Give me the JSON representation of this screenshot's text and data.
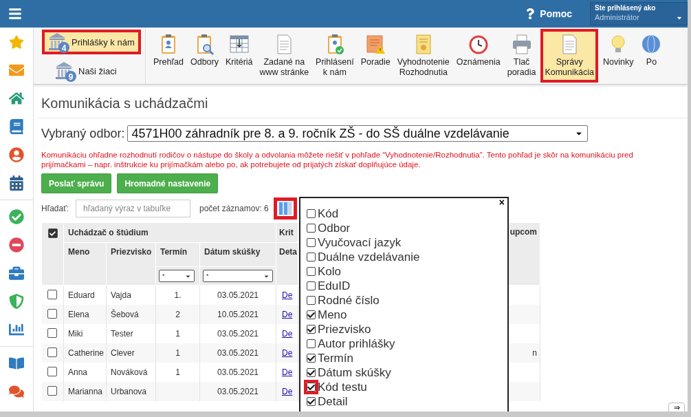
{
  "header": {
    "help": "Pomoc",
    "user_label": "Ste prihlásený ako",
    "user": "Administrátor"
  },
  "toolbar": {
    "left": [
      {
        "label": "Prihlášky k nám",
        "badge": "4",
        "highlighted": true
      },
      {
        "label": "Naši žiaci",
        "badge": "9",
        "highlighted": false
      }
    ],
    "items": [
      {
        "lines": [
          "Prehľad"
        ],
        "highlighted": false
      },
      {
        "lines": [
          "Odbory"
        ],
        "highlighted": false
      },
      {
        "lines": [
          "Kritériá"
        ],
        "highlighted": false
      },
      {
        "lines": [
          "Zadané na",
          "www stránke"
        ],
        "highlighted": false
      },
      {
        "lines": [
          "Prihlásení",
          "k nám"
        ],
        "highlighted": false
      },
      {
        "lines": [
          "Poradie"
        ],
        "highlighted": false
      },
      {
        "lines": [
          "Vyhodnotenie",
          "Rozhodnutia"
        ],
        "highlighted": false
      },
      {
        "lines": [
          "Oznámenia"
        ],
        "highlighted": false
      },
      {
        "lines": [
          "Tlač",
          "poradia"
        ],
        "highlighted": false
      },
      {
        "lines": [
          "Správy",
          "Komunikácia"
        ],
        "highlighted": true
      },
      {
        "lines": [
          "Novinky"
        ],
        "highlighted": false
      },
      {
        "lines": [
          "Po"
        ],
        "highlighted": false
      }
    ]
  },
  "page": {
    "title": "Komunikácia s uchádzačmi",
    "odbor_label": "Vybraný odbor:",
    "odbor_value": "4571H00 záhradník pre 8. a 9. ročník ZŠ - do SŠ duálne vzdelávanie",
    "note": "Komunikáciu ohľadne rozhodnutí rodičov o nástupe do školy a odvolania môžete riešiť v pohľade “Vyhodnotenie/Rozhodnutia”. Tento pohľad je skôr na komunikáciu pred prijímačkami – napr. inštrukcie ku prijímačkám alebo po, ak potrebujete od prijatých získať doplňujúce údaje.",
    "buttons": [
      "Poslať správu",
      "Hromadné nastavenie"
    ],
    "search_label": "Hľadať:",
    "search_placeholder": "hľadaný výraz v tabuľke",
    "count": "počet záznamov: 6",
    "columns_button_highlighted": true
  },
  "table": {
    "select_all_checked": true,
    "group": "Uchádzač o štúdium",
    "column_6": "Krit",
    "column_7": "upcom",
    "columns": [
      "Meno",
      "Priezvisko",
      "Termín",
      "Dátum skúšky",
      "Deta"
    ],
    "filters": [
      "*",
      "*"
    ],
    "rows": [
      {
        "checked": false,
        "meno": "Eduard",
        "priezvisko": "Vajda",
        "termin": "1.",
        "datum": "03.05.2021",
        "link": "De",
        "column_7": ""
      },
      {
        "checked": false,
        "meno": "Elena",
        "priezvisko": "Šebová",
        "termin": "2",
        "datum": "10.05.2021",
        "link": "De",
        "column_7": ""
      },
      {
        "checked": false,
        "meno": "Miki",
        "priezvisko": "Tester",
        "termin": "1",
        "datum": "03.05.2021",
        "link": "De",
        "column_7": ""
      },
      {
        "checked": false,
        "meno": "Catherine",
        "priezvisko": "Clever",
        "termin": "1",
        "datum": "03.05.2021",
        "link": "De",
        "column_7": "n"
      },
      {
        "checked": false,
        "meno": "Anna",
        "priezvisko": "Nováková",
        "termin": "1",
        "datum": "03.05.2021",
        "link": "De",
        "column_7": ""
      },
      {
        "checked": false,
        "meno": "Marianna",
        "priezvisko": "Urbanova",
        "termin": "",
        "datum": "03.05.2021",
        "link": "De",
        "column_7": ""
      }
    ]
  },
  "column_popup": {
    "close": "×",
    "items": [
      {
        "label": "Kód",
        "checked": false,
        "highlighted": false
      },
      {
        "label": "Odbor",
        "checked": false,
        "highlighted": false
      },
      {
        "label": "Vyučovací jazyk",
        "checked": false,
        "highlighted": false
      },
      {
        "label": "Duálne vzdelávanie",
        "checked": false,
        "highlighted": false
      },
      {
        "label": "Kolo",
        "checked": false,
        "highlighted": false
      },
      {
        "label": "EduID",
        "checked": false,
        "highlighted": false
      },
      {
        "label": "Rodné číslo",
        "checked": false,
        "highlighted": false
      },
      {
        "label": "Meno",
        "checked": true,
        "highlighted": false
      },
      {
        "label": "Priezvisko",
        "checked": true,
        "highlighted": false
      },
      {
        "label": "Autor prihlášky",
        "checked": false,
        "highlighted": false
      },
      {
        "label": "Termín",
        "checked": true,
        "highlighted": false
      },
      {
        "label": "Dátum skúšky",
        "checked": true,
        "highlighted": false
      },
      {
        "label": "Kód testu",
        "checked": true,
        "highlighted": true
      },
      {
        "label": "Detail",
        "checked": true,
        "highlighted": false
      }
    ]
  },
  "scroll_button": "⇒"
}
